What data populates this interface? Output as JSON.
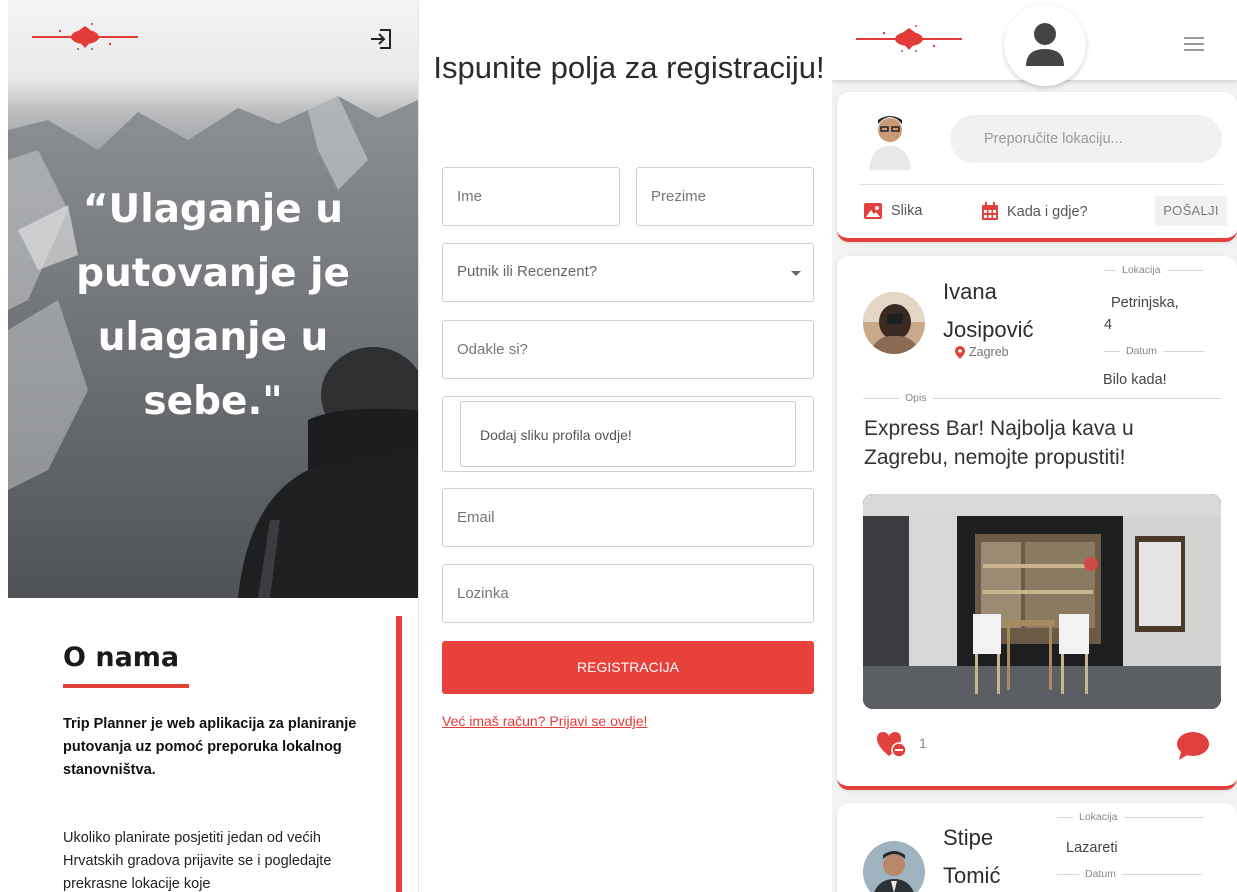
{
  "left": {
    "quote": "“Ulaganje u putovanje je ulaganje u sebe.\"",
    "about_title": "O nama",
    "about_bold": "Trip Planner je web aplikacija za planiranje putovanja uz pomoć preporuka lokalnog stanovništva.",
    "about_text": "Ukoliko planirate posjetiti jedan od većih Hrvatskih gradova prijavite se i pogledajte prekrasne lokacije koje",
    "icons": {
      "logo": "airplane-logo",
      "login": "login-icon"
    }
  },
  "registration": {
    "title": "Ispunite polja za registraciju!",
    "first_name_placeholder": "Ime",
    "last_name_placeholder": "Prezime",
    "role_select": "Putnik ili Recenzent?",
    "origin_placeholder": "Odakle si?",
    "profile_upload": "Dodaj sliku profila ovdje!",
    "email_placeholder": "Email",
    "password_placeholder": "Lozinka",
    "submit_label": "REGISTRACIJA",
    "login_link": "Već imaš račun? Prijavi se ovdje!"
  },
  "feed": {
    "composer": {
      "placeholder": "Preporučite lokaciju...",
      "photo_label": "Slika",
      "when_where_label": "Kada i gdje?",
      "send_label": "POŠALJI"
    },
    "posts": [
      {
        "first_name": "Ivana",
        "last_name": "Josipović",
        "city": "Zagreb",
        "location_label": "Lokacija",
        "location_line1": "Petrinjska,",
        "location_line2": "4",
        "date_label": "Datum",
        "date_value": "Bilo kada!",
        "description_label": "Opis",
        "description": "Express Bar! Najbolja kava u Zagrebu, nemojte propustiti!",
        "likes": "1"
      },
      {
        "first_name": "Stipe",
        "last_name": "Tomić",
        "location_label": "Lokacija",
        "location_line1": "Lazareti",
        "date_label": "Datum"
      }
    ]
  },
  "colors": {
    "accent": "#e2403c",
    "button": "#e8403b",
    "link": "#e33b37"
  }
}
